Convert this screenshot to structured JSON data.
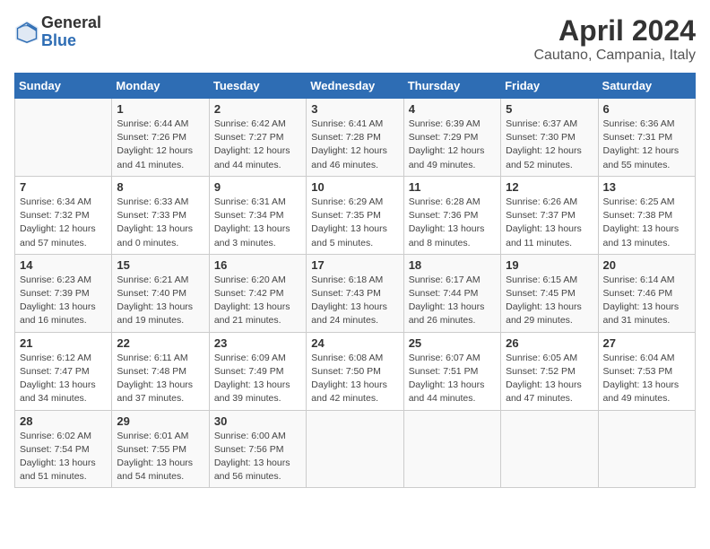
{
  "header": {
    "logo_general": "General",
    "logo_blue": "Blue",
    "title": "April 2024",
    "subtitle": "Cautano, Campania, Italy"
  },
  "columns": [
    "Sunday",
    "Monday",
    "Tuesday",
    "Wednesday",
    "Thursday",
    "Friday",
    "Saturday"
  ],
  "weeks": [
    [
      {
        "day": "",
        "info": ""
      },
      {
        "day": "1",
        "info": "Sunrise: 6:44 AM\nSunset: 7:26 PM\nDaylight: 12 hours\nand 41 minutes."
      },
      {
        "day": "2",
        "info": "Sunrise: 6:42 AM\nSunset: 7:27 PM\nDaylight: 12 hours\nand 44 minutes."
      },
      {
        "day": "3",
        "info": "Sunrise: 6:41 AM\nSunset: 7:28 PM\nDaylight: 12 hours\nand 46 minutes."
      },
      {
        "day": "4",
        "info": "Sunrise: 6:39 AM\nSunset: 7:29 PM\nDaylight: 12 hours\nand 49 minutes."
      },
      {
        "day": "5",
        "info": "Sunrise: 6:37 AM\nSunset: 7:30 PM\nDaylight: 12 hours\nand 52 minutes."
      },
      {
        "day": "6",
        "info": "Sunrise: 6:36 AM\nSunset: 7:31 PM\nDaylight: 12 hours\nand 55 minutes."
      }
    ],
    [
      {
        "day": "7",
        "info": "Sunrise: 6:34 AM\nSunset: 7:32 PM\nDaylight: 12 hours\nand 57 minutes."
      },
      {
        "day": "8",
        "info": "Sunrise: 6:33 AM\nSunset: 7:33 PM\nDaylight: 13 hours\nand 0 minutes."
      },
      {
        "day": "9",
        "info": "Sunrise: 6:31 AM\nSunset: 7:34 PM\nDaylight: 13 hours\nand 3 minutes."
      },
      {
        "day": "10",
        "info": "Sunrise: 6:29 AM\nSunset: 7:35 PM\nDaylight: 13 hours\nand 5 minutes."
      },
      {
        "day": "11",
        "info": "Sunrise: 6:28 AM\nSunset: 7:36 PM\nDaylight: 13 hours\nand 8 minutes."
      },
      {
        "day": "12",
        "info": "Sunrise: 6:26 AM\nSunset: 7:37 PM\nDaylight: 13 hours\nand 11 minutes."
      },
      {
        "day": "13",
        "info": "Sunrise: 6:25 AM\nSunset: 7:38 PM\nDaylight: 13 hours\nand 13 minutes."
      }
    ],
    [
      {
        "day": "14",
        "info": "Sunrise: 6:23 AM\nSunset: 7:39 PM\nDaylight: 13 hours\nand 16 minutes."
      },
      {
        "day": "15",
        "info": "Sunrise: 6:21 AM\nSunset: 7:40 PM\nDaylight: 13 hours\nand 19 minutes."
      },
      {
        "day": "16",
        "info": "Sunrise: 6:20 AM\nSunset: 7:42 PM\nDaylight: 13 hours\nand 21 minutes."
      },
      {
        "day": "17",
        "info": "Sunrise: 6:18 AM\nSunset: 7:43 PM\nDaylight: 13 hours\nand 24 minutes."
      },
      {
        "day": "18",
        "info": "Sunrise: 6:17 AM\nSunset: 7:44 PM\nDaylight: 13 hours\nand 26 minutes."
      },
      {
        "day": "19",
        "info": "Sunrise: 6:15 AM\nSunset: 7:45 PM\nDaylight: 13 hours\nand 29 minutes."
      },
      {
        "day": "20",
        "info": "Sunrise: 6:14 AM\nSunset: 7:46 PM\nDaylight: 13 hours\nand 31 minutes."
      }
    ],
    [
      {
        "day": "21",
        "info": "Sunrise: 6:12 AM\nSunset: 7:47 PM\nDaylight: 13 hours\nand 34 minutes."
      },
      {
        "day": "22",
        "info": "Sunrise: 6:11 AM\nSunset: 7:48 PM\nDaylight: 13 hours\nand 37 minutes."
      },
      {
        "day": "23",
        "info": "Sunrise: 6:09 AM\nSunset: 7:49 PM\nDaylight: 13 hours\nand 39 minutes."
      },
      {
        "day": "24",
        "info": "Sunrise: 6:08 AM\nSunset: 7:50 PM\nDaylight: 13 hours\nand 42 minutes."
      },
      {
        "day": "25",
        "info": "Sunrise: 6:07 AM\nSunset: 7:51 PM\nDaylight: 13 hours\nand 44 minutes."
      },
      {
        "day": "26",
        "info": "Sunrise: 6:05 AM\nSunset: 7:52 PM\nDaylight: 13 hours\nand 47 minutes."
      },
      {
        "day": "27",
        "info": "Sunrise: 6:04 AM\nSunset: 7:53 PM\nDaylight: 13 hours\nand 49 minutes."
      }
    ],
    [
      {
        "day": "28",
        "info": "Sunrise: 6:02 AM\nSunset: 7:54 PM\nDaylight: 13 hours\nand 51 minutes."
      },
      {
        "day": "29",
        "info": "Sunrise: 6:01 AM\nSunset: 7:55 PM\nDaylight: 13 hours\nand 54 minutes."
      },
      {
        "day": "30",
        "info": "Sunrise: 6:00 AM\nSunset: 7:56 PM\nDaylight: 13 hours\nand 56 minutes."
      },
      {
        "day": "",
        "info": ""
      },
      {
        "day": "",
        "info": ""
      },
      {
        "day": "",
        "info": ""
      },
      {
        "day": "",
        "info": ""
      }
    ]
  ]
}
